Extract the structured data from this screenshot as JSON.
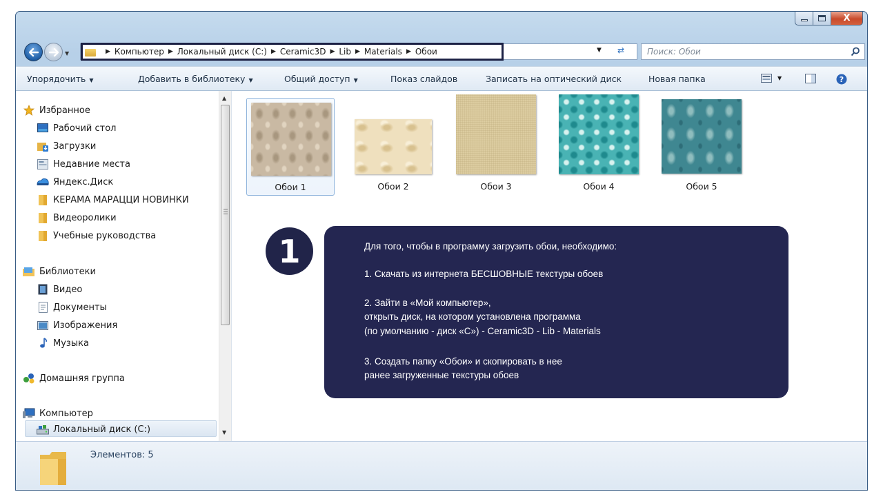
{
  "window": {
    "min_label": "–",
    "max_label": "",
    "close_label": "X"
  },
  "address": {
    "crumbs": [
      "Компьютер",
      "Локальный диск (C:)",
      "Ceramic3D",
      "Lib",
      "Materials",
      "Обои"
    ],
    "separator": "▶"
  },
  "search": {
    "placeholder": "Поиск: Обои"
  },
  "toolbar": {
    "organize": "Упорядочить",
    "add_library": "Добавить в библиотеку",
    "share": "Общий доступ",
    "slideshow": "Показ слайдов",
    "burn": "Записать на оптический диск",
    "new_folder": "Новая папка"
  },
  "sidebar": {
    "favorites": "Избранное",
    "desktop": "Рабочий стол",
    "downloads": "Загрузки",
    "recent": "Недавние места",
    "yandex": "Яндекс.Диск",
    "kerama": "КЕРАМА МАРАЦЦИ НОВИНКИ",
    "videos_folder": "Видеоролики",
    "tutorials": "Учебные руководства",
    "libraries": "Библиотеки",
    "video": "Видео",
    "documents": "Документы",
    "images": "Изображения",
    "music": "Музыка",
    "homegroup": "Домашняя группа",
    "computer": "Компьютер",
    "local_disk": "Локальный диск (C:)"
  },
  "files": [
    {
      "label": "Обои 1",
      "texture": "beige-damask"
    },
    {
      "label": "Обои 2",
      "texture": "cream-marble"
    },
    {
      "label": "Обои 3",
      "texture": "tan-linen"
    },
    {
      "label": "Обои 4",
      "texture": "turquoise-floral"
    },
    {
      "label": "Обои 5",
      "texture": "teal-damask"
    }
  ],
  "status": {
    "count_text": "Элементов: 5"
  },
  "annotation": {
    "step": "1",
    "lines": [
      "Для того, чтобы в программу загрузить обои, необходимо:",
      "1. Скачать из интернета БЕСШОВНЫЕ текстуры обоев",
      "2. Зайти в «Мой компьютер»,",
      "открыть диск, на котором установлена  программа",
      "(по умолчанию - диск «С»)  - Ceramic3D - Lib - Materials",
      "3. Создать папку «Обои» и скопировать в нее",
      "ранее загруженные текстуры обоев"
    ]
  },
  "colors": {
    "callout_bg": "#242651",
    "highlight_border": "#1c2144",
    "window_frame": "#b9d1e9"
  }
}
